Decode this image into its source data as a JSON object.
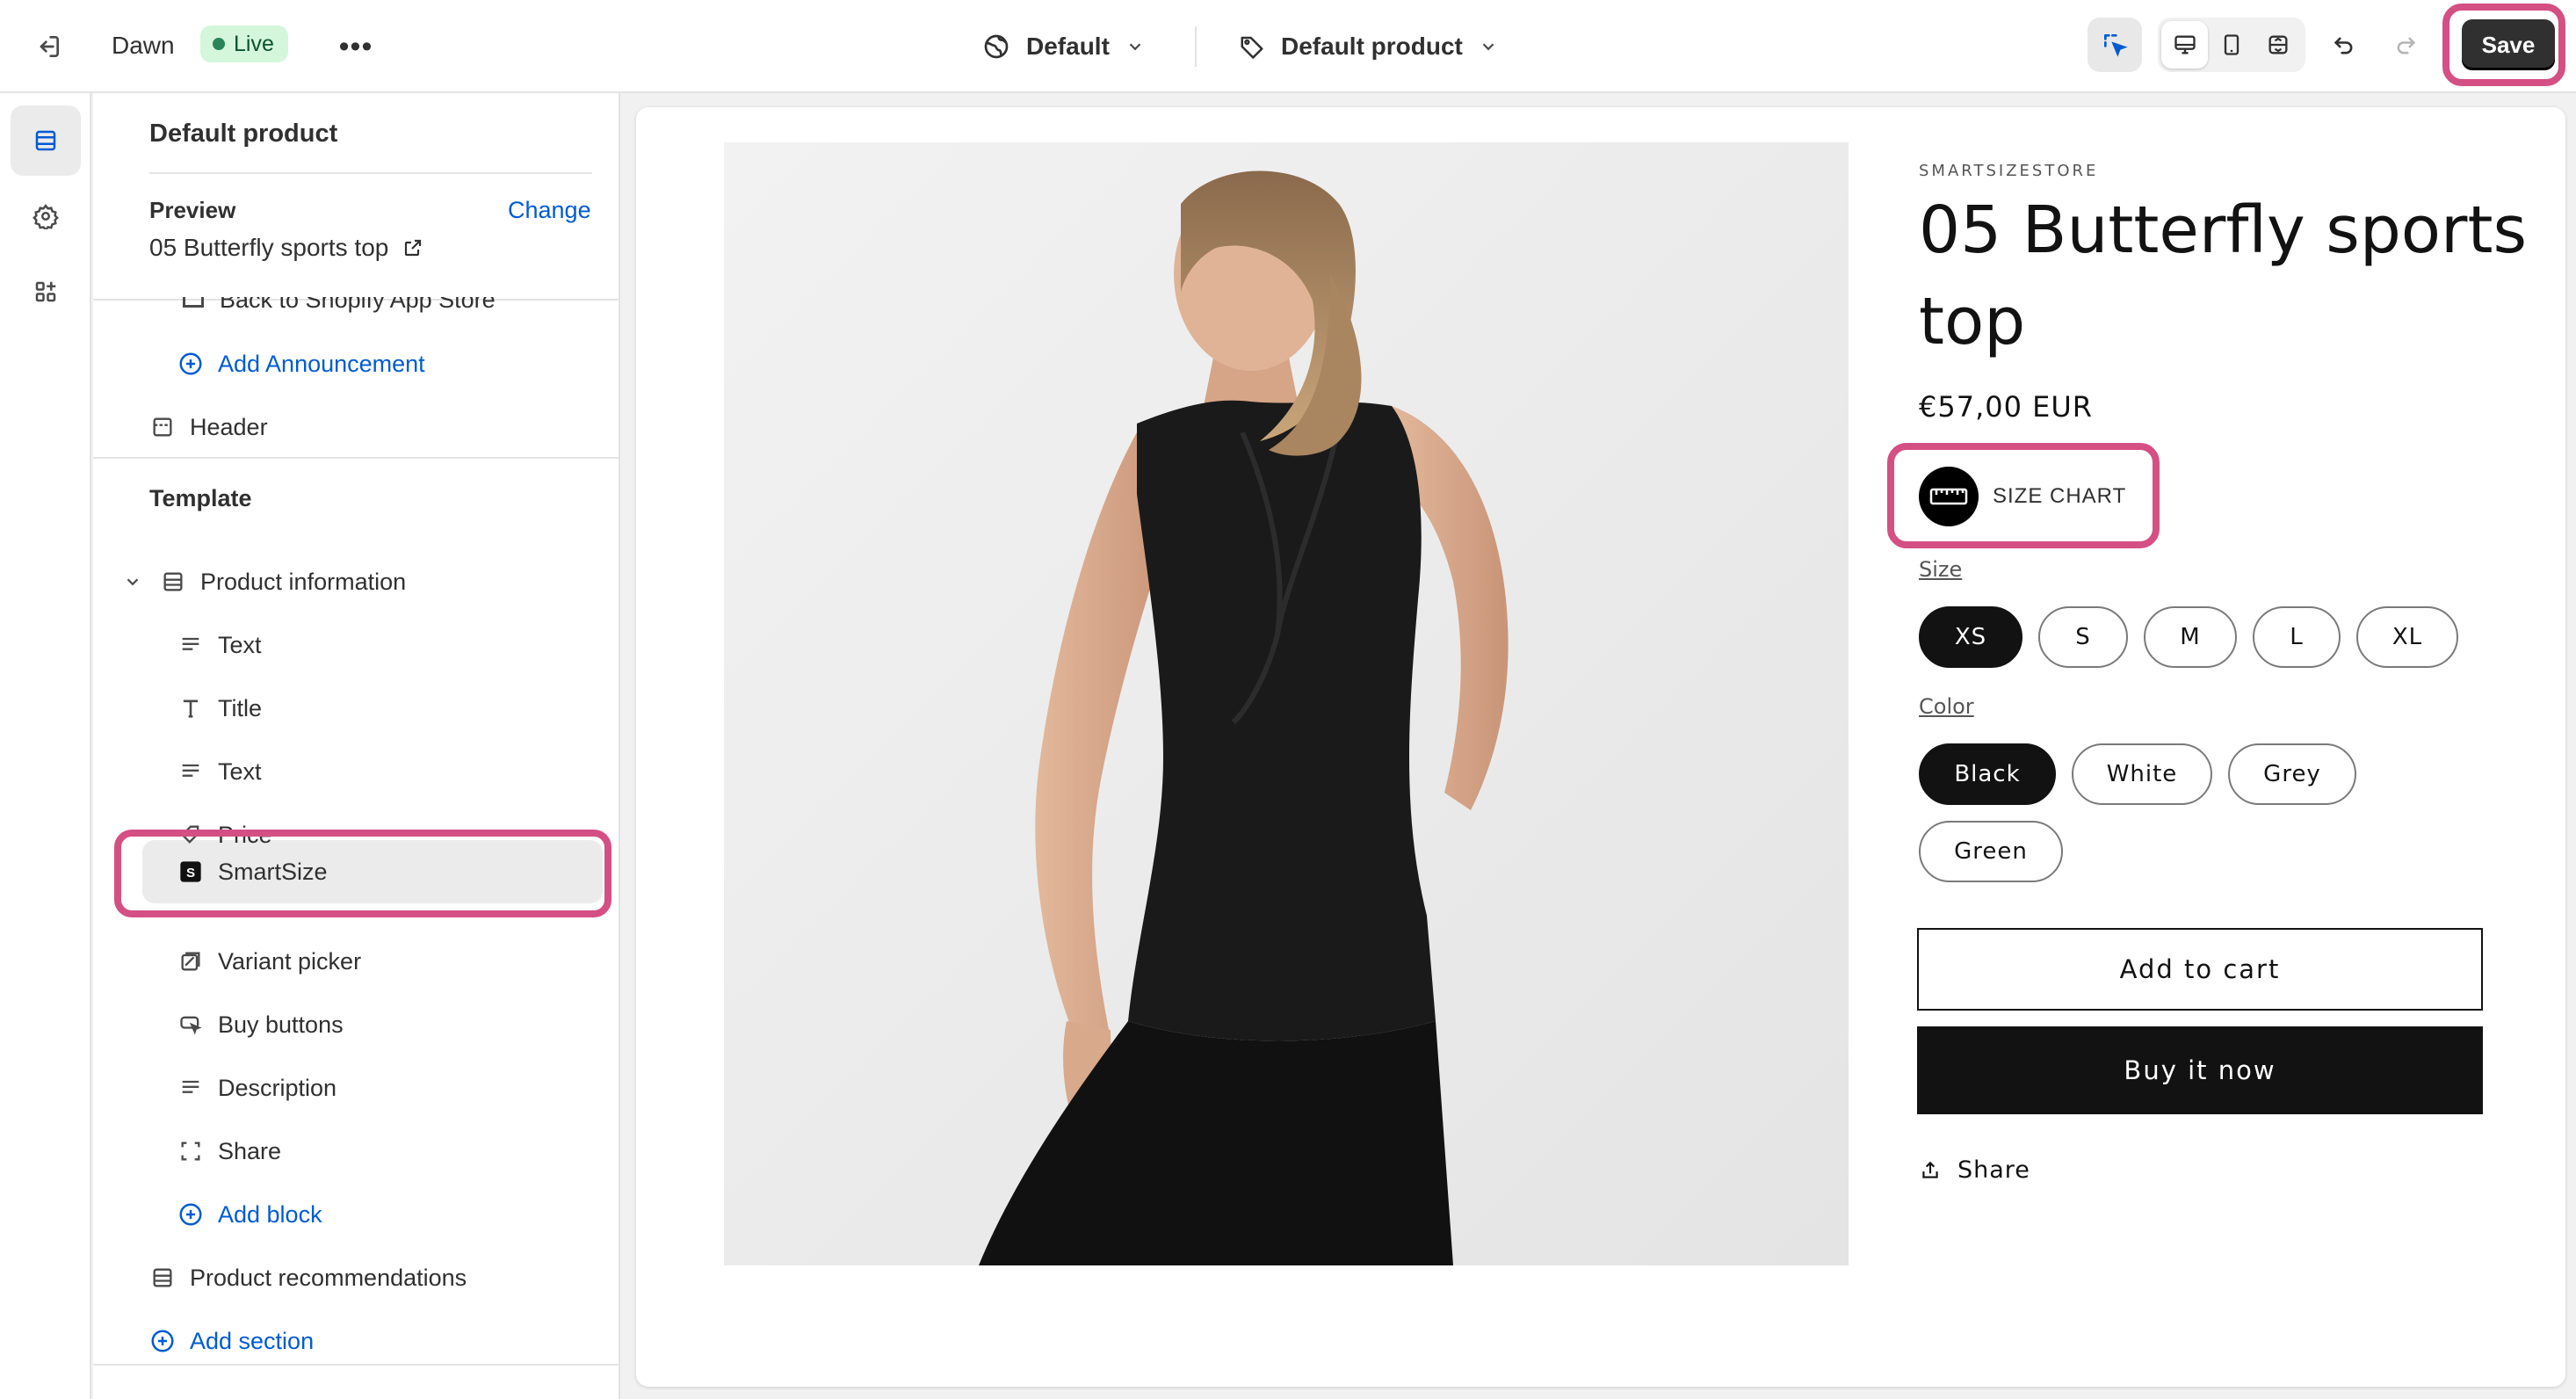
{
  "topbar": {
    "theme_name": "Dawn",
    "status": "Live",
    "more": "•••",
    "theme_selector": "Default",
    "template_selector": "Default product",
    "save_label": "Save"
  },
  "sidebar": {
    "title": "Default product",
    "preview_label": "Preview",
    "change_label": "Change",
    "preview_product": "05 Butterfly sports top",
    "clipped_item": "Back to Shopify App Store",
    "add_announcement": "Add Announcement",
    "header": "Header",
    "template_label": "Template",
    "product_information": "Product information",
    "blocks": [
      {
        "label": "Text",
        "icon": "text-icon"
      },
      {
        "label": "Title",
        "icon": "title-icon"
      },
      {
        "label": "Text",
        "icon": "text-icon"
      },
      {
        "label": "Price",
        "icon": "price-tag-icon"
      },
      {
        "label": "SmartSize",
        "icon": "smartsize-app-icon"
      },
      {
        "label": "Variant picker",
        "icon": "variant-picker-icon"
      },
      {
        "label": "Buy buttons",
        "icon": "buy-buttons-icon"
      },
      {
        "label": "Description",
        "icon": "text-icon"
      },
      {
        "label": "Share",
        "icon": "share-frame-icon"
      }
    ],
    "add_block": "Add block",
    "product_recommendations": "Product recommendations",
    "add_section": "Add section"
  },
  "product": {
    "vendor": "SMARTSIZESTORE",
    "title": "05 Butterfly sports top",
    "price": "€57,00 EUR",
    "size_chart": "SIZE CHART",
    "size_label": "Size",
    "sizes": [
      "XS",
      "S",
      "M",
      "L",
      "XL"
    ],
    "selected_size": "XS",
    "color_label": "Color",
    "colors": [
      "Black",
      "White",
      "Grey",
      "Green"
    ],
    "selected_color": "Black",
    "add_to_cart": "Add to cart",
    "buy_now": "Buy it now",
    "share": "Share"
  },
  "colors": {
    "highlight": "#d44f84",
    "link": "#005bd3",
    "live_badge_bg": "#d4f6db",
    "dark": "#121212"
  }
}
